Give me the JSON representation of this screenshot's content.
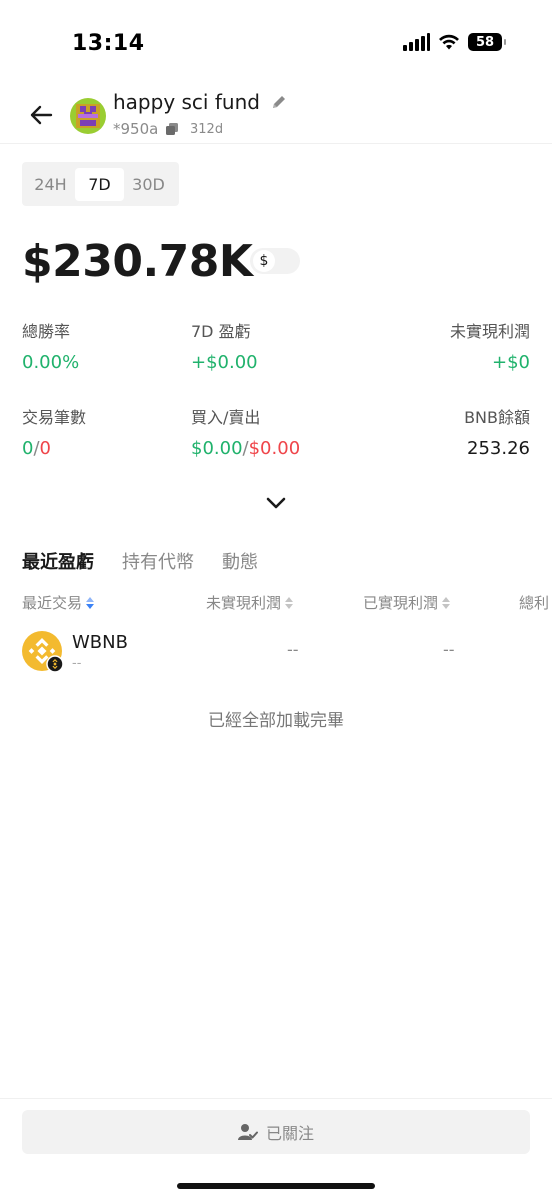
{
  "status_bar": {
    "time": "13:14",
    "battery": "58"
  },
  "header": {
    "wallet_name": "happy sci fund",
    "address": "*950a",
    "age": "312d"
  },
  "range_tabs": [
    {
      "label": "24H",
      "active": false
    },
    {
      "label": "7D",
      "active": true
    },
    {
      "label": "30D",
      "active": false
    }
  ],
  "balance": {
    "value": "$230.78K",
    "currency_symbol": "$"
  },
  "stats": {
    "win_rate": {
      "label": "總勝率",
      "value": "0.00%"
    },
    "pnl": {
      "label": "7D 盈虧",
      "value": "+$0.00"
    },
    "unrealized": {
      "label": "未實現利潤",
      "value": "+$0"
    },
    "trades": {
      "label": "交易筆數",
      "wins": "0",
      "separator": "/",
      "losses": "0"
    },
    "buy_sell": {
      "label": "買入/賣出",
      "buy": "$0.00",
      "separator": "/",
      "sell": "$0.00"
    },
    "bnb_balance": {
      "label": "BNB餘額",
      "value": "253.26"
    }
  },
  "section_tabs": [
    {
      "label": "最近盈虧",
      "active": true
    },
    {
      "label": "持有代幣",
      "active": false
    },
    {
      "label": "動態",
      "active": false
    }
  ],
  "table": {
    "columns": [
      "最近交易",
      "未實現利潤",
      "已實現利潤",
      "總利"
    ],
    "rows": [
      {
        "token": "WBNB",
        "sub": "--",
        "unrealized": "--",
        "realized": "--"
      }
    ]
  },
  "loaded_message": "已經全部加載完畢",
  "follow_button": {
    "label": "已關注"
  },
  "colors": {
    "positive": "#20b26c",
    "negative": "#ef454a",
    "accent_sort": "#3b82f6",
    "bnb_yellow": "#f3ba2f"
  }
}
